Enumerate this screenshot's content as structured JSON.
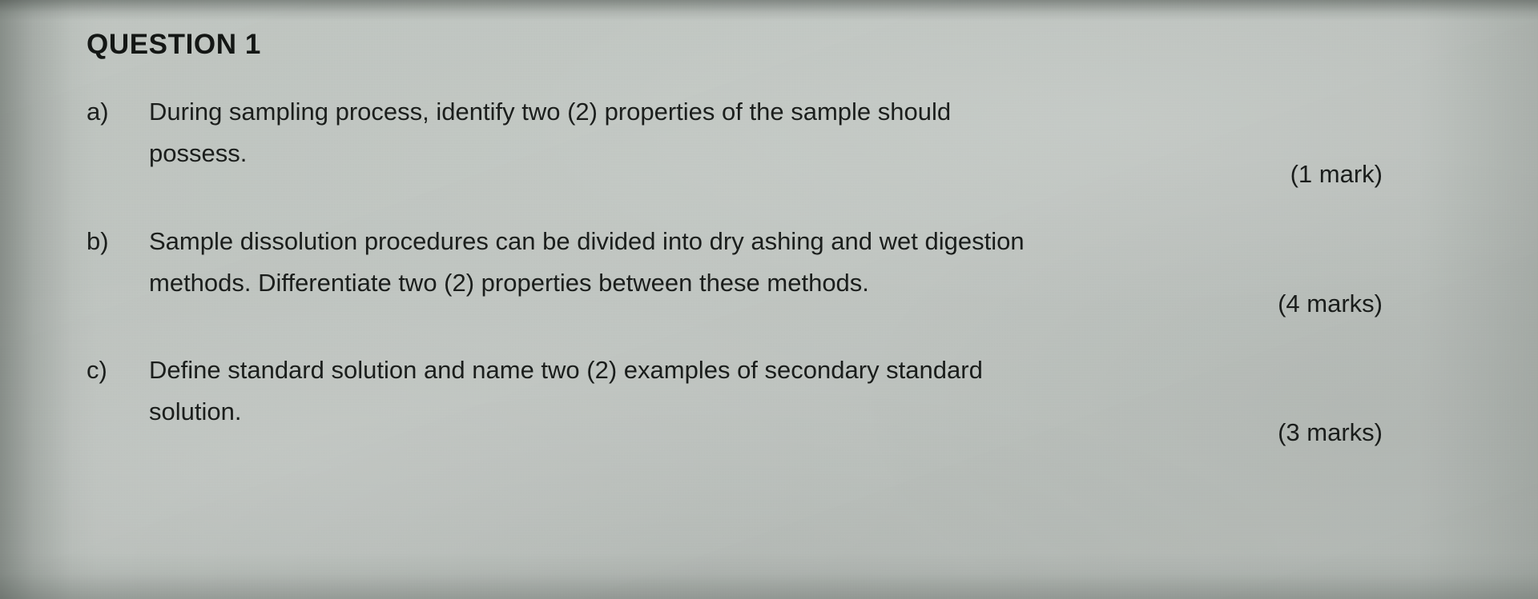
{
  "document": {
    "title": "QUESTION 1",
    "items": [
      {
        "marker": "a)",
        "line1": "During sampling process, identify two (2) properties of the sample should",
        "line2": "possess.",
        "marks": "(1 mark)"
      },
      {
        "marker": "b)",
        "line1": "Sample dissolution procedures can be divided into dry ashing and wet digestion",
        "line2": "methods. Differentiate two (2) properties between these methods.",
        "marks": "(4 marks)"
      },
      {
        "marker": "c)",
        "line1": "Define standard solution and name two (2) examples of secondary standard",
        "line2": "solution.",
        "marks": "(3 marks)"
      }
    ]
  },
  "appearance": {
    "paper_color": "#c6cbc7",
    "ink_color": "#1b1e1c"
  }
}
